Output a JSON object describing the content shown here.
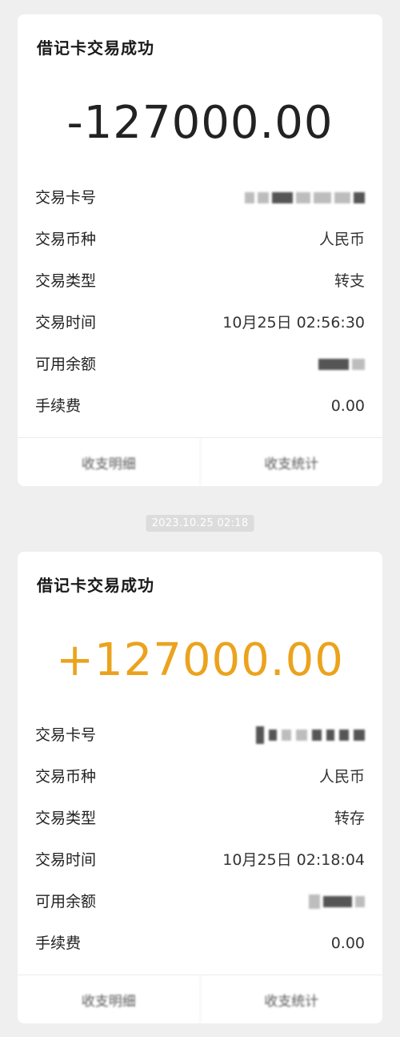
{
  "cards": [
    {
      "title": "借记卡交易成功",
      "amount": "-127000.00",
      "rows": [
        {
          "label": "交易卡号",
          "value": ""
        },
        {
          "label": "交易币种",
          "value": "人民币"
        },
        {
          "label": "交易类型",
          "value": "转支"
        },
        {
          "label": "交易时间",
          "value": "10月25日 02:56:30"
        },
        {
          "label": "可用余额",
          "value": ""
        },
        {
          "label": "手续费",
          "value": "0.00"
        }
      ],
      "actions": [
        "收支明细",
        "收支统计"
      ]
    },
    {
      "title": "借记卡交易成功",
      "amount": "+127000.00",
      "rows": [
        {
          "label": "交易卡号",
          "value": ""
        },
        {
          "label": "交易币种",
          "value": "人民币"
        },
        {
          "label": "交易类型",
          "value": "转存"
        },
        {
          "label": "交易时间",
          "value": "10月25日 02:18:04"
        },
        {
          "label": "可用余额",
          "value": ""
        },
        {
          "label": "手续费",
          "value": "0.00"
        }
      ],
      "actions": [
        "收支明细",
        "收支统计"
      ]
    }
  ],
  "timestamp": "2023.10.25 02:18",
  "colors": {
    "credit": "#eba31d",
    "debit": "#222222",
    "background": "#efefef"
  }
}
